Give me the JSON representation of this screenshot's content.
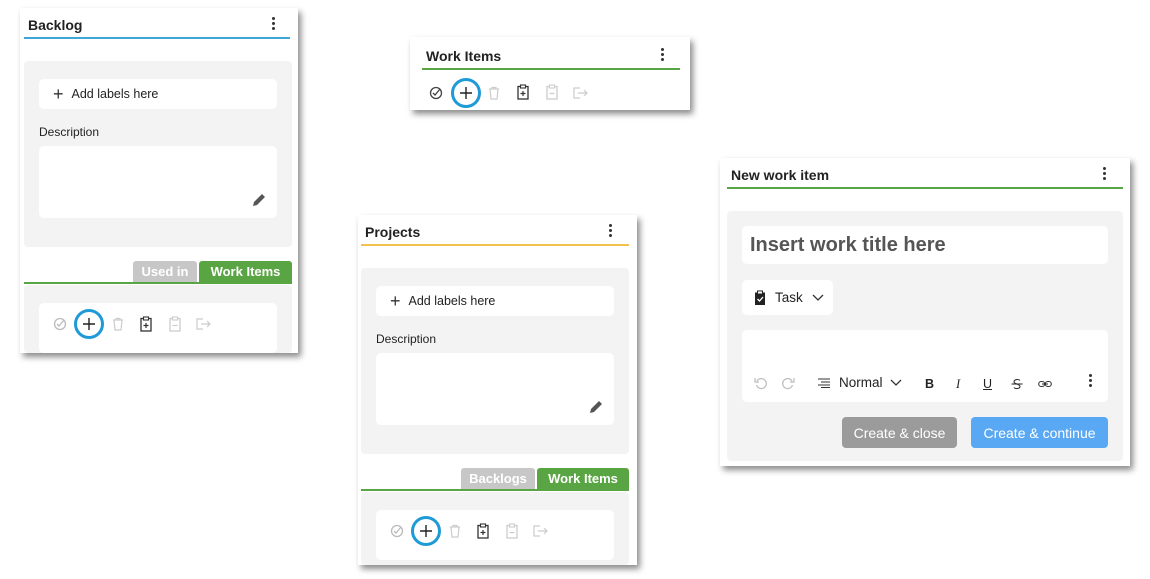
{
  "backlog": {
    "title": "Backlog",
    "add_labels": "Add labels here",
    "description_label": "Description",
    "tabs": [
      "Used in",
      "Work Items"
    ]
  },
  "work_items": {
    "title": "Work Items"
  },
  "projects": {
    "title": "Projects",
    "add_labels": "Add labels here",
    "description_label": "Description",
    "tabs": [
      "Backlogs",
      "Work Items"
    ]
  },
  "new_work_item": {
    "title": "New work item",
    "title_placeholder": "Insert work title here",
    "type_select": "Task",
    "editor": {
      "text_style": "Normal",
      "bold": "B",
      "italic": "I",
      "underline": "U"
    },
    "create_close": "Create & close",
    "create_continue": "Create & continue"
  },
  "colors": {
    "backlog_line": "#3fa6dc",
    "work_items_line": "#5aa543",
    "projects_line": "#f2c24d",
    "highlight_ring": "#1e9ad6",
    "btn_grey": "#9b9b9b",
    "btn_blue": "#59a8f4"
  }
}
